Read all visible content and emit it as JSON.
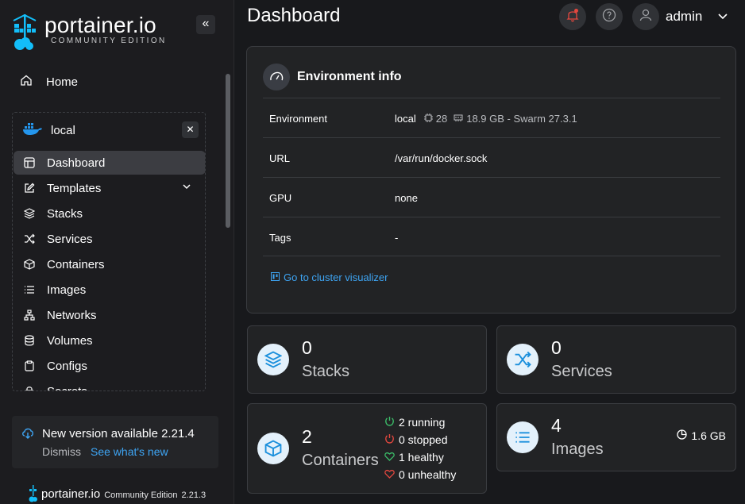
{
  "brand": {
    "name": "portainer.io",
    "edition": "COMMUNITY EDITION"
  },
  "sidebar": {
    "home": "Home",
    "environment": {
      "name": "local"
    },
    "items": [
      {
        "label": "Dashboard",
        "icon": "dashboard-icon"
      },
      {
        "label": "Templates",
        "icon": "edit-icon"
      },
      {
        "label": "Stacks",
        "icon": "layers-icon"
      },
      {
        "label": "Services",
        "icon": "shuffle-icon"
      },
      {
        "label": "Containers",
        "icon": "box-icon"
      },
      {
        "label": "Images",
        "icon": "list-icon"
      },
      {
        "label": "Networks",
        "icon": "network-icon"
      },
      {
        "label": "Volumes",
        "icon": "database-icon"
      },
      {
        "label": "Configs",
        "icon": "clipboard-icon"
      },
      {
        "label": "Secrets",
        "icon": "lock-icon"
      }
    ],
    "update": {
      "title": "New version available 2.21.4",
      "dismiss": "Dismiss",
      "link": "See what's new"
    },
    "footer": {
      "name": "portainer.io",
      "edition": "Community Edition",
      "version": "2.21.3"
    }
  },
  "header": {
    "title": "Dashboard",
    "user": "admin"
  },
  "env_info": {
    "title": "Environment info",
    "rows": [
      {
        "key": "Environment",
        "value": "local",
        "cpu": "28",
        "memory": "18.9 GB - Swarm 27.3.1"
      },
      {
        "key": "URL",
        "value": "/var/run/docker.sock"
      },
      {
        "key": "GPU",
        "value": "none"
      },
      {
        "key": "Tags",
        "value": "-"
      }
    ],
    "link": "Go to cluster visualizer"
  },
  "stats": {
    "stacks": {
      "count": "0",
      "label": "Stacks"
    },
    "services": {
      "count": "0",
      "label": "Services"
    },
    "containers": {
      "count": "2",
      "label": "Containers",
      "running": "2 running",
      "stopped": "0 stopped",
      "healthy": "1 healthy",
      "unhealthy": "0 unhealthy"
    },
    "images": {
      "count": "4",
      "label": "Images",
      "size": "1.6 GB"
    }
  },
  "colors": {
    "accent": "#3ea5f4",
    "bg": "#18191c",
    "card": "#222325",
    "green": "#3cbf6a",
    "red": "#e5483f"
  }
}
